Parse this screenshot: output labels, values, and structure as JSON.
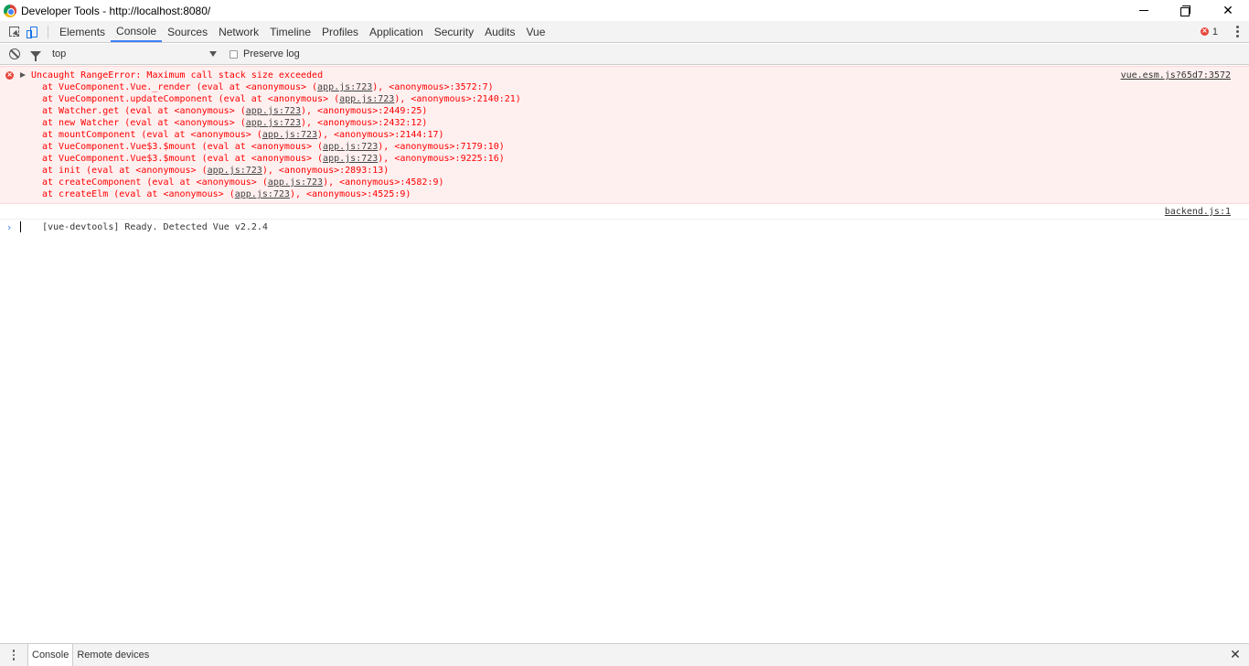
{
  "window": {
    "title": "Developer Tools - http://localhost:8080/"
  },
  "tabs": [
    "Elements",
    "Console",
    "Sources",
    "Network",
    "Timeline",
    "Profiles",
    "Application",
    "Security",
    "Audits",
    "Vue"
  ],
  "active_tab": "Console",
  "error_count": "1",
  "filter": {
    "context": "top",
    "preserve_log_label": "Preserve log"
  },
  "error": {
    "message": "Uncaught RangeError: Maximum call stack size exceeded",
    "source": "vue.esm.js?65d7:3572",
    "stack": [
      {
        "pre": "at VueComponent.Vue._render (eval at <anonymous> (",
        "link": "app.js:723",
        "post": "), <anonymous>:3572:7)"
      },
      {
        "pre": "at VueComponent.updateComponent (eval at <anonymous> (",
        "link": "app.js:723",
        "post": "), <anonymous>:2140:21)"
      },
      {
        "pre": "at Watcher.get (eval at <anonymous> (",
        "link": "app.js:723",
        "post": "), <anonymous>:2449:25)"
      },
      {
        "pre": "at new Watcher (eval at <anonymous> (",
        "link": "app.js:723",
        "post": "), <anonymous>:2432:12)"
      },
      {
        "pre": "at mountComponent (eval at <anonymous> (",
        "link": "app.js:723",
        "post": "), <anonymous>:2144:17)"
      },
      {
        "pre": "at VueComponent.Vue$3.$mount (eval at <anonymous> (",
        "link": "app.js:723",
        "post": "), <anonymous>:7179:10)"
      },
      {
        "pre": "at VueComponent.Vue$3.$mount (eval at <anonymous> (",
        "link": "app.js:723",
        "post": "), <anonymous>:9225:16)"
      },
      {
        "pre": "at init (eval at <anonymous> (",
        "link": "app.js:723",
        "post": "), <anonymous>:2893:13)"
      },
      {
        "pre": "at createComponent (eval at <anonymous> (",
        "link": "app.js:723",
        "post": "), <anonymous>:4582:9)"
      },
      {
        "pre": "at createElm (eval at <anonymous> (",
        "link": "app.js:723",
        "post": "), <anonymous>:4525:9)"
      }
    ]
  },
  "log": {
    "message": "[vue-devtools] Ready. Detected Vue v2.2.4",
    "source": "backend.js:1"
  },
  "drawer": {
    "tabs": [
      "Console",
      "Remote devices"
    ],
    "active": "Console"
  },
  "colors": {
    "error_text": "#ff0000",
    "error_bg": "#fff0f0",
    "accent": "#3e82f7"
  }
}
